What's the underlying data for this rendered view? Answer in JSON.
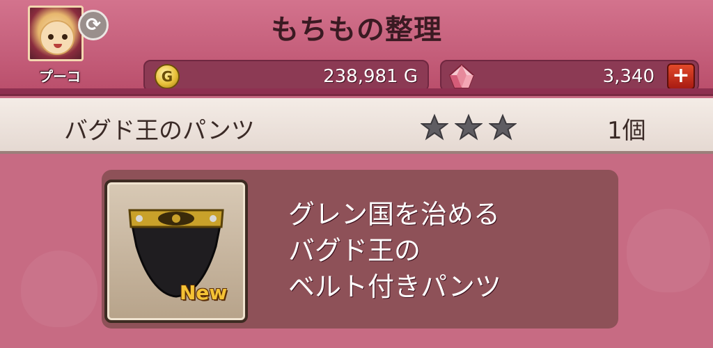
{
  "header": {
    "title": "もちもの整理",
    "player_name": "プーコ"
  },
  "currency": {
    "gold": "238,981 G",
    "gems": "3,340",
    "plus_label": "+"
  },
  "item": {
    "name": "バグド王のパンツ",
    "rarity_stars": 3,
    "count": "1個",
    "new_label": "New",
    "description_lines": [
      "グレン国を治める",
      "バグド王の",
      "ベルト付きパンツ"
    ]
  },
  "colors": {
    "header": "#c55f7b",
    "panel": "#7a4648",
    "gold": "#e8c13a",
    "plus_button": "#c2281a"
  },
  "icons": {
    "refresh": "refresh-icon",
    "coin": "gold-coin-icon",
    "gem": "gem-icon",
    "star": "star-icon",
    "item": "belt-pants-icon"
  }
}
